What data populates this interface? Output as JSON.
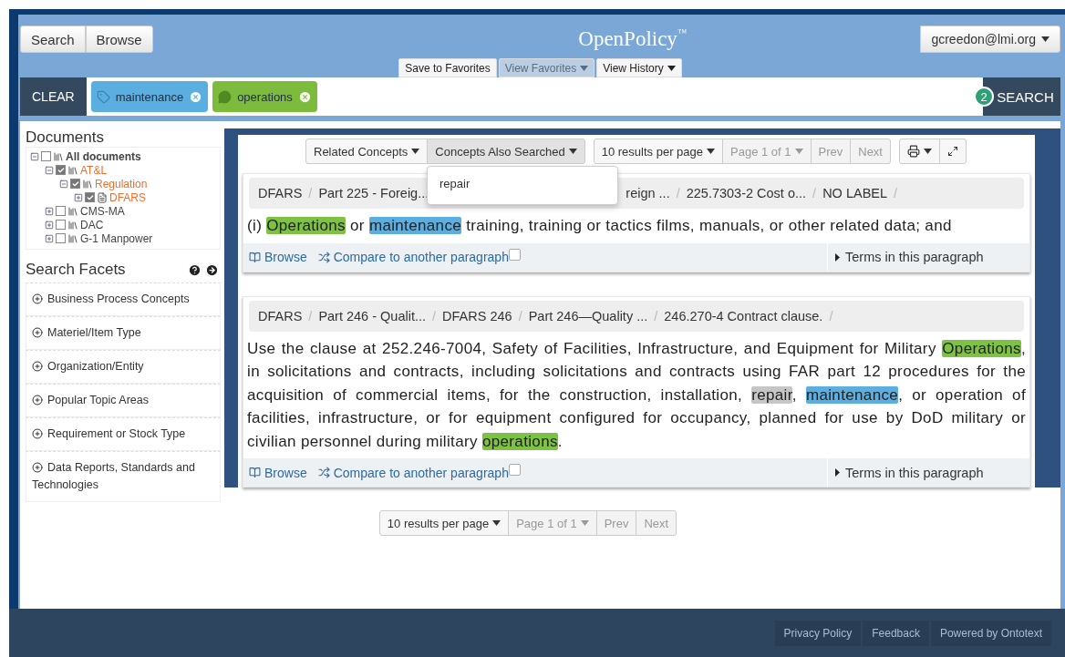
{
  "header": {
    "nav_buttons": [
      {
        "label": "Search"
      },
      {
        "label": "Browse"
      }
    ],
    "title": "OpenPolicy",
    "trademark": "™",
    "user": "gcreedon@lmi.org"
  },
  "favorites_bar": [
    {
      "label": "Save to Favorites",
      "has_menu": false,
      "selected": false
    },
    {
      "label": "View Favorites",
      "has_menu": true,
      "selected": true
    },
    {
      "label": "View History",
      "has_menu": true,
      "selected": false
    }
  ],
  "filter_bar": {
    "clear": "CLEAR",
    "tags": [
      {
        "label": "maintenance",
        "kind": "tag",
        "color": "#5aaee0"
      },
      {
        "label": "operations",
        "kind": "comment",
        "color": "#7dbb3c"
      }
    ],
    "count": "2",
    "search": "SEARCH"
  },
  "sidebar": {
    "documents_title": "Documents",
    "tree": [
      {
        "label": "All documents",
        "kind": "collection",
        "checked": false,
        "expanded": true,
        "children": [
          {
            "label": "AT&L",
            "kind": "collection",
            "checked": true,
            "expanded": true,
            "children": [
              {
                "label": "Regulation",
                "kind": "collection",
                "checked": true,
                "expanded": true,
                "children": [
                  {
                    "label": "DFARS",
                    "kind": "document",
                    "checked": true,
                    "expanded": false
                  }
                ]
              }
            ]
          },
          {
            "label": "CMS-MA",
            "kind": "collection",
            "checked": false,
            "expanded": false
          },
          {
            "label": "DAC",
            "kind": "collection",
            "checked": false,
            "expanded": false
          },
          {
            "label": "G-1 Manpower",
            "kind": "collection",
            "checked": false,
            "expanded": false
          }
        ]
      }
    ],
    "facets_title": "Search Facets",
    "facets": [
      "Business Process Concepts",
      "Materiel/Item Type",
      "Organization/Entity",
      "Popular Topic Areas",
      "Requirement or Stock Type",
      "Data Reports, Standards and Technologies"
    ]
  },
  "toolbar": {
    "concept_buttons": [
      {
        "label": "Related Concepts",
        "selected": false
      },
      {
        "label": "Concepts Also Searched",
        "selected": true
      }
    ],
    "dropdown": [
      "repair"
    ],
    "per_page": "10  results per page",
    "page": "Page 1 of 1",
    "prev": "Prev",
    "next": "Next"
  },
  "results": [
    {
      "separator": "/",
      "breadcrumbs": [
        "DFARS",
        "Part 225 - Foreig...",
        "reign ...",
        "225.7303-2 Cost o...",
        "NO LABEL"
      ],
      "paragraph": [
        {
          "text": "(i) "
        },
        {
          "text": "Operations",
          "color": "#7dc242"
        },
        {
          "text": " or "
        },
        {
          "text": "maintenance",
          "color": "#5aaee0"
        },
        {
          "text": " training, training or tactics films, manuals, or other related data; and"
        }
      ],
      "browse": "Browse",
      "compare": "Compare to another paragraph",
      "compare_checked": false,
      "terms": "Terms in this paragraph"
    },
    {
      "separator": "/",
      "breadcrumbs": [
        "DFARS",
        "Part 246 - Qualit...",
        "DFARS 246",
        "Part 246—Quality ...",
        "246.270-4 Contract clause."
      ],
      "paragraph": [
        {
          "text": "Use the clause at 252.246-7004, Safety of Facilities, Infrastructure, and Equipment for Military "
        },
        {
          "text": "Operations",
          "color": "#7dc242"
        },
        {
          "text": ", in solicitations and contracts, including solicitations and contracts using FAR part 12 procedures for the acquisition of commercial items, for the construction, installation, "
        },
        {
          "text": "repair",
          "color": "#c6c6c6"
        },
        {
          "text": ", "
        },
        {
          "text": "maintenance",
          "color": "#5aaee0"
        },
        {
          "text": ", or operation of facilities, infrastructure, or for equipment configured for occupancy, planned for use by DoD military or civilian personnel during military "
        },
        {
          "text": "operations",
          "color": "#7dc242"
        },
        {
          "text": "."
        }
      ],
      "browse": "Browse",
      "compare": "Compare to another paragraph",
      "compare_checked": false,
      "terms": "Terms in this paragraph"
    }
  ],
  "bottom_pager": {
    "per_page": "10  results per page",
    "page": "Page 1 of 1",
    "prev": "Prev",
    "next": "Next"
  },
  "footer_links": [
    "Privacy Policy",
    "Feedback",
    "Powered by Ontotext"
  ]
}
